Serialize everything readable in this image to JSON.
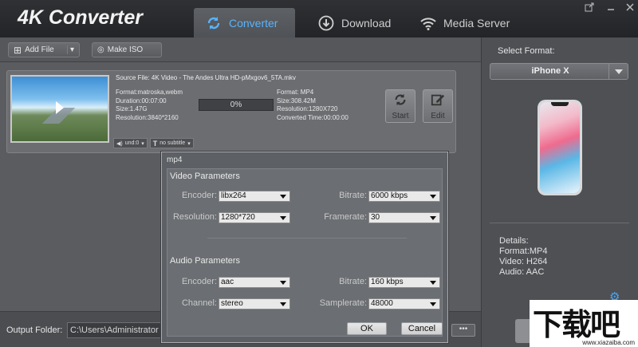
{
  "app": {
    "title": "4K Converter"
  },
  "tabs": [
    {
      "label": "Converter",
      "icon": "refresh-icon",
      "active": true
    },
    {
      "label": "Download",
      "icon": "download-icon",
      "active": false
    },
    {
      "label": "Media Server",
      "icon": "wifi-icon",
      "active": false
    }
  ],
  "toolbar": {
    "add_file": "Add File",
    "make_iso": "Make ISO"
  },
  "file": {
    "source": "Source File: 4K Video - The Andes Ultra HD-pMxgov6_5TA.mkv",
    "src_format": "Format:matroska,webm",
    "src_duration": "Duration:00:07:00",
    "src_size": "Size:1.47G",
    "src_resolution": "Resolution:3840*2160",
    "progress": "0%",
    "dst_format": "Format: MP4",
    "dst_size": "Size:308.42M",
    "dst_resolution": "Resolution:1280X720",
    "dst_time": "Converted Time:00:00:00",
    "start": "Start",
    "edit": "Edit",
    "audio_track": "und:0",
    "subtitle": "no subtitle"
  },
  "right_panel": {
    "select_label": "Select Format:",
    "format": "iPhone X",
    "details": [
      "Details:",
      "Format:MP4",
      "Video: H264",
      "Audio: AAC"
    ]
  },
  "bottom": {
    "output_label": "Output Folder:",
    "output_path": "C:\\Users\\Administrator",
    "browse": "•••"
  },
  "dialog": {
    "title": "mp4",
    "video_section": "Video Parameters",
    "encoder_label": "Encoder:",
    "encoder": "libx264",
    "bitrate_label": "Bitrate:",
    "bitrate": "6000 kbps",
    "resolution_label": "Resolution:",
    "resolution": "1280*720",
    "framerate_label": "Framerate:",
    "framerate": "30",
    "audio_section": "Audio Parameters",
    "a_encoder_label": "Encoder:",
    "a_encoder": "aac",
    "a_bitrate_label": "Bitrate:",
    "a_bitrate": "160 kbps",
    "channel_label": "Channel:",
    "channel": "stereo",
    "samplerate_label": "Samplerate:",
    "samplerate": "48000",
    "ok": "OK",
    "cancel": "Cancel"
  },
  "watermark": {
    "text": "下载吧",
    "url": "www.xiazaiba.com"
  }
}
